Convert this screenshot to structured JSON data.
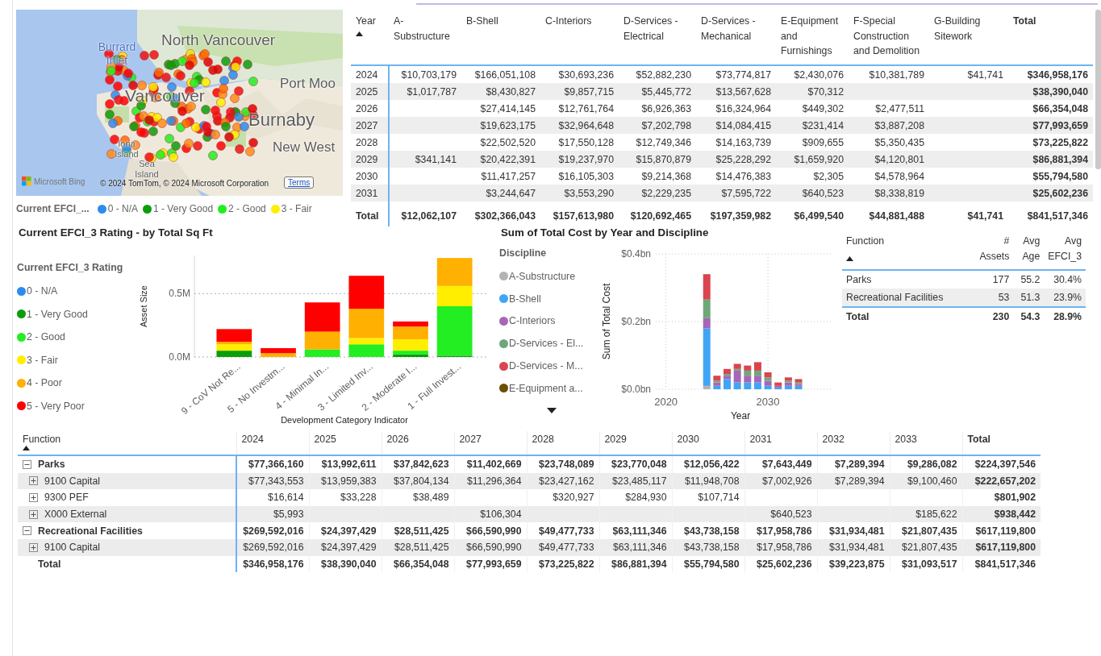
{
  "map": {
    "labels": [
      "North Vancouver",
      "Burrard Inlet",
      "Port Moo",
      "Vancouver",
      "Burnaby",
      "Iona Island",
      "New West",
      "Sea Island"
    ],
    "provider": "Microsoft Bing",
    "attribution": "© 2024 TomTom, © 2024 Microsoft Corporation",
    "terms": "Terms"
  },
  "map_legend": {
    "title": "Current EFCI_...",
    "items": [
      {
        "label": "0 - N/A",
        "color": "#2b8cf0"
      },
      {
        "label": "1 - Very Good",
        "color": "#0a9e0a"
      },
      {
        "label": "2 - Good",
        "color": "#22ee22"
      },
      {
        "label": "3 - Fair",
        "color": "#ffee00"
      }
    ]
  },
  "cost_table": {
    "columns": [
      "Year",
      "A-Substructure",
      "B-Shell",
      "C-Interiors",
      "D-Services - Electrical",
      "D-Services - Mechanical",
      "E-Equipment and Furnishings",
      "F-Special Construction and Demolition",
      "G-Building Sitework",
      "Total"
    ],
    "rows": [
      [
        "2024",
        "$10,703,179",
        "$166,051,108",
        "$30,693,236",
        "$52,882,230",
        "$73,774,817",
        "$2,430,076",
        "$10,381,789",
        "$41,741",
        "$346,958,176"
      ],
      [
        "2025",
        "$1,017,787",
        "$8,430,827",
        "$9,857,715",
        "$5,445,772",
        "$13,567,628",
        "$70,312",
        null,
        null,
        "$38,390,040"
      ],
      [
        "2026",
        null,
        "$27,414,145",
        "$12,761,764",
        "$6,926,363",
        "$16,324,964",
        "$449,302",
        "$2,477,511",
        null,
        "$66,354,048"
      ],
      [
        "2027",
        null,
        "$19,623,175",
        "$32,964,648",
        "$7,202,798",
        "$14,084,415",
        "$231,414",
        "$3,887,208",
        null,
        "$77,993,659"
      ],
      [
        "2028",
        null,
        "$22,502,520",
        "$17,550,128",
        "$12,749,346",
        "$14,163,739",
        "$909,655",
        "$5,350,435",
        null,
        "$73,225,822"
      ],
      [
        "2029",
        "$341,141",
        "$20,422,391",
        "$19,237,970",
        "$15,870,879",
        "$25,228,292",
        "$1,659,920",
        "$4,120,801",
        null,
        "$86,881,394"
      ],
      [
        "2030",
        null,
        "$11,417,257",
        "$16,105,303",
        "$9,214,368",
        "$14,476,383",
        "$2,305",
        "$4,578,964",
        null,
        "$55,794,580"
      ],
      [
        "2031",
        null,
        "$3,244,647",
        "$3,553,290",
        "$2,229,235",
        "$7,595,722",
        "$640,523",
        "$8,338,819",
        null,
        "$25,602,236"
      ]
    ],
    "total": [
      "Total",
      "$12,062,107",
      "$302,366,043",
      "$157,613,980",
      "$120,692,465",
      "$197,359,982",
      "$6,499,540",
      "$44,881,488",
      "$41,741",
      "$841,517,346"
    ]
  },
  "rating_chart": {
    "title": "Current EFCI_3 Rating - by Total Sq Ft",
    "legend_title": "Current EFCI_3 Rating",
    "chart_data": {
      "type": "bar",
      "stacked": true,
      "grid": true,
      "xlabel": "Development Category Indicator",
      "ylabel": "Asset Size",
      "categories": [
        "9 - CoV Not Re...",
        "5 - No Investm...",
        "4 - Minimal In...",
        "3 - Limited Inv...",
        "2 - Moderate I...",
        "1 - Full Invest..."
      ],
      "ylim": [
        0,
        0.8
      ],
      "yticks": [
        {
          "value": 0,
          "label": "0.0M"
        },
        {
          "value": 0.5,
          "label": "0.5M"
        }
      ],
      "series": [
        {
          "name": "0 - N/A",
          "color": "#2b8cf0",
          "values": [
            0,
            0,
            0,
            0,
            0,
            0
          ]
        },
        {
          "name": "1 - Very Good",
          "color": "#0a9e0a",
          "values": [
            0.05,
            0,
            0,
            0,
            0.02,
            0.01
          ]
        },
        {
          "name": "2 - Good",
          "color": "#22ee22",
          "values": [
            0,
            0,
            0.06,
            0.1,
            0.03,
            0.39
          ]
        },
        {
          "name": "3 - Fair",
          "color": "#ffee00",
          "values": [
            0.05,
            0,
            0,
            0.05,
            0.09,
            0.16
          ]
        },
        {
          "name": "4 - Poor",
          "color": "#ffb000",
          "values": [
            0.02,
            0.03,
            0.14,
            0.23,
            0.1,
            0.22
          ]
        },
        {
          "name": "5 - Very Poor",
          "color": "#ff0000",
          "values": [
            0.1,
            0.04,
            0.23,
            0.26,
            0.04,
            0
          ]
        }
      ]
    }
  },
  "cost_chart": {
    "title": "Sum of Total Cost by Year and Discipline",
    "legend_title": "Discipline",
    "chart_data": {
      "type": "bar",
      "stacked": true,
      "grid": true,
      "xlabel": "Year",
      "ylabel": "Sum of Total Cost",
      "x": [
        2024,
        2025,
        2026,
        2027,
        2028,
        2029,
        2030,
        2031,
        2032,
        2033
      ],
      "xlim": [
        2019,
        2036.4
      ],
      "ylim": [
        0,
        0.4
      ],
      "xticks": [
        2020,
        2030
      ],
      "yticks": [
        {
          "value": 0,
          "label": "$0.0bn"
        },
        {
          "value": 0.2,
          "label": "$0.2bn"
        },
        {
          "value": 0.4,
          "label": "$0.4bn"
        }
      ],
      "series": [
        {
          "name": "A-Substructure",
          "color": "#b3b3b3",
          "values": [
            0.01,
            0,
            0,
            0,
            0,
            0,
            0,
            0,
            0,
            0
          ]
        },
        {
          "name": "B-Shell",
          "color": "#41a5f5",
          "values": [
            0.17,
            0.01,
            0.03,
            0.02,
            0.02,
            0.02,
            0.01,
            0.005,
            0.01,
            0.01
          ]
        },
        {
          "name": "C-Interiors",
          "color": "#a666b9",
          "values": [
            0.03,
            0.01,
            0.01,
            0.035,
            0.02,
            0.02,
            0.015,
            0.005,
            0.01,
            0.005
          ]
        },
        {
          "name": "D-Services - El...",
          "color": "#6fa878",
          "values": [
            0.055,
            0.005,
            0.005,
            0.005,
            0.015,
            0.015,
            0.01,
            0,
            0.005,
            0.005
          ]
        },
        {
          "name": "D-Services - M...",
          "color": "#d9444f",
          "values": [
            0.075,
            0.015,
            0.015,
            0.015,
            0.015,
            0.025,
            0.015,
            0.01,
            0.01,
            0.01
          ]
        },
        {
          "name": "E-Equipment a...",
          "color": "#6b5000",
          "values": [
            0,
            0,
            0,
            0,
            0,
            0,
            0,
            0,
            0,
            0
          ]
        }
      ]
    }
  },
  "function_table": {
    "columns": [
      "Function",
      "# Assets",
      "Avg Age",
      "Avg EFCI_3"
    ],
    "rows": [
      [
        "Parks",
        "177",
        "55.2",
        "30.4%"
      ],
      [
        "Recreational Facilities",
        "53",
        "51.3",
        "23.9%"
      ]
    ],
    "total": [
      "Total",
      "230",
      "54.3",
      "28.9%"
    ]
  },
  "matrix": {
    "columns": [
      "Function",
      "2024",
      "2025",
      "2026",
      "2027",
      "2028",
      "2029",
      "2030",
      "2031",
      "2032",
      "2033",
      "Total"
    ],
    "rows": [
      {
        "kind": "group",
        "expanded": true,
        "cells": [
          "Parks",
          "$77,366,160",
          "$13,992,611",
          "$37,842,623",
          "$11,402,669",
          "$23,748,089",
          "$23,770,048",
          "$12,056,422",
          "$7,643,449",
          "$7,289,394",
          "$9,286,082",
          "$224,397,546"
        ]
      },
      {
        "kind": "child",
        "expanded": false,
        "cells": [
          "9100 Capital",
          "$77,343,553",
          "$13,959,383",
          "$37,804,134",
          "$11,296,364",
          "$23,427,162",
          "$23,485,117",
          "$11,948,708",
          "$7,002,926",
          "$7,289,394",
          "$9,100,460",
          "$222,657,202"
        ]
      },
      {
        "kind": "child",
        "expanded": false,
        "cells": [
          "9300 PEF",
          "$16,614",
          "$33,228",
          "$38,489",
          null,
          "$320,927",
          "$284,930",
          "$107,714",
          null,
          null,
          null,
          "$801,902"
        ]
      },
      {
        "kind": "child",
        "expanded": false,
        "cells": [
          "X000 External",
          "$5,993",
          null,
          null,
          "$106,304",
          null,
          null,
          null,
          "$640,523",
          null,
          "$185,622",
          "$938,442"
        ]
      },
      {
        "kind": "group",
        "expanded": true,
        "cells": [
          "Recreational Facilities",
          "$269,592,016",
          "$24,397,429",
          "$28,511,425",
          "$66,590,990",
          "$49,477,733",
          "$63,111,346",
          "$43,738,158",
          "$17,958,786",
          "$31,934,481",
          "$21,807,435",
          "$617,119,800"
        ]
      },
      {
        "kind": "child",
        "expanded": false,
        "cells": [
          "9100 Capital",
          "$269,592,016",
          "$24,397,429",
          "$28,511,425",
          "$66,590,990",
          "$49,477,733",
          "$63,111,346",
          "$43,738,158",
          "$17,958,786",
          "$31,934,481",
          "$21,807,435",
          "$617,119,800"
        ]
      },
      {
        "kind": "total",
        "cells": [
          "Total",
          "$346,958,176",
          "$38,390,040",
          "$66,354,048",
          "$77,993,659",
          "$73,225,822",
          "$86,881,394",
          "$55,794,580",
          "$25,602,236",
          "$39,223,875",
          "$31,093,517",
          "$841,517,346"
        ]
      }
    ]
  }
}
